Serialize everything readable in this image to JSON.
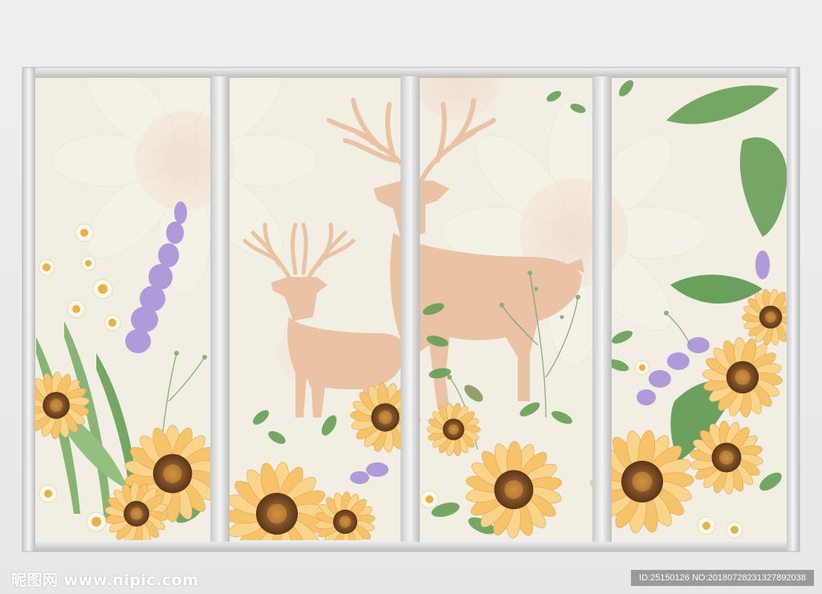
{
  "scene": {
    "subject": "four-panel window frame mural with deer silhouettes and sunflowers",
    "panels": 4,
    "colors": {
      "frame": "#d6d6d6",
      "canvas": "#f2eee3",
      "deer": "#e9c3a4",
      "sunflower_petal": "#f6c36b",
      "sunflower_center": "#8a5a2b",
      "leaf": "#6aa05a",
      "lavender": "#a892d8",
      "bg_flower_pink": "#f1c8b3"
    }
  },
  "watermark": {
    "left": "昵图网 www.nipic.com",
    "right": "ID:25150126 NO:20180728231327892038"
  }
}
